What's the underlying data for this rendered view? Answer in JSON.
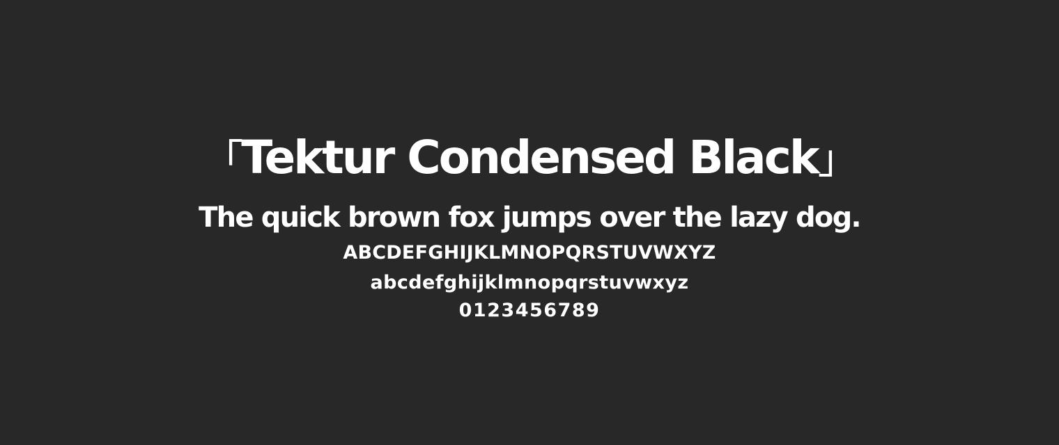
{
  "specimen": {
    "open_bracket": "「",
    "font_name": "Tektur Condensed Black",
    "close_bracket": "」",
    "pangram": "The quick brown fox jumps over the lazy dog.",
    "uppercase": "ABCDEFGHIJKLMNOPQRSTUVWXYZ",
    "lowercase": "abcdefghijklmnopqrstuvwxyz",
    "digits": "0123456789"
  },
  "colors": {
    "background": "#282828",
    "text": "#ffffff"
  }
}
